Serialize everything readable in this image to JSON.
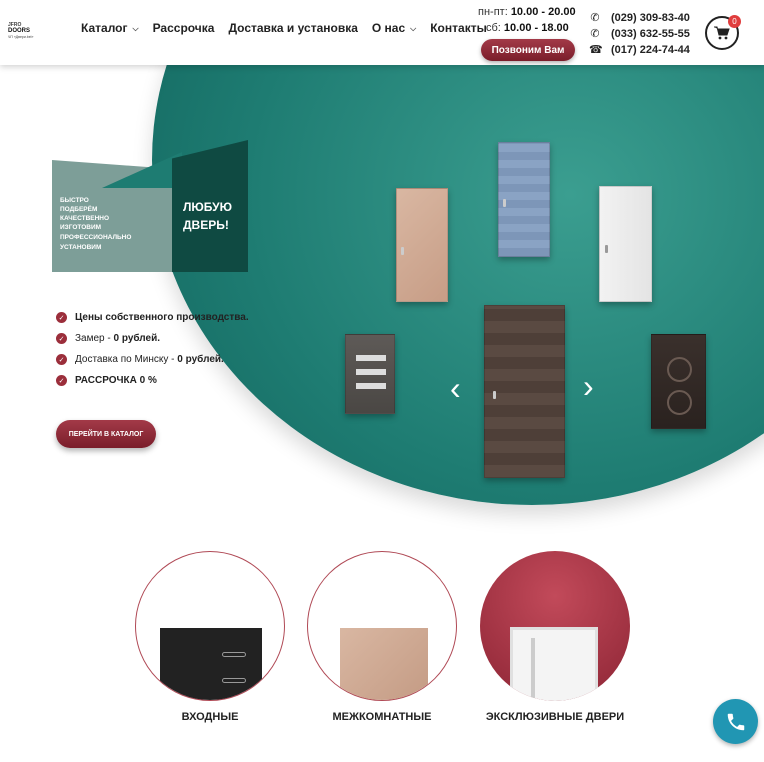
{
  "logo": {
    "line1": "JFRO",
    "line2": "DOORS",
    "line3": "ЧП «Двери.bel»"
  },
  "nav": [
    {
      "label": "Каталог",
      "dropdown": true
    },
    {
      "label": "Рассрочка",
      "dropdown": false
    },
    {
      "label": "Доставка и установка",
      "dropdown": false
    },
    {
      "label": "О нас",
      "dropdown": true
    },
    {
      "label": "Контакты",
      "dropdown": false
    }
  ],
  "hours": {
    "weekday_label": "пн-пт:",
    "weekday": "10.00 - 20.00",
    "sat_label": "сб:",
    "sat": "10.00 - 18.00"
  },
  "callme_label": "Позвоним Вам",
  "phones": [
    {
      "icon": "mobile-phone-icon",
      "number": "(029) 309-83-40"
    },
    {
      "icon": "mobile-phone-icon",
      "number": "(033) 632-55-55"
    },
    {
      "icon": "landline-phone-icon",
      "number": "(017) 224-74-44"
    }
  ],
  "cart": {
    "icon": "cart-icon",
    "count": "0"
  },
  "banner": {
    "lines": [
      "БЫСТРО ПОДБЕРЁМ",
      "КАЧЕСТВЕННО ИЗГОТОВИМ",
      "ПРОФЕССИОНАЛЬНО",
      "УСТАНОВИМ"
    ],
    "headline1": "ЛЮБУЮ",
    "headline2": "ДВЕРЬ!"
  },
  "features": [
    {
      "pre": "Цены собственного производства.",
      "bold": ""
    },
    {
      "pre": "Замер - ",
      "bold": "0 рублей."
    },
    {
      "pre": "Доставка по Минску - ",
      "bold": "0 рублей."
    },
    {
      "pre": "РАССРОЧКА 0 %",
      "bold": ""
    }
  ],
  "catalog_button": "ПЕРЕЙТИ В КАТАЛОГ",
  "categories": [
    {
      "label": "ВХОДНЫЕ"
    },
    {
      "label": "МЕЖКОМНАТНЫЕ"
    },
    {
      "label": "ЭКСКЛЮЗИВНЫЕ ДВЕРИ"
    }
  ],
  "colors": {
    "accent": "#8c2434",
    "teal": "#1e7c72",
    "fab": "#2196b3"
  }
}
